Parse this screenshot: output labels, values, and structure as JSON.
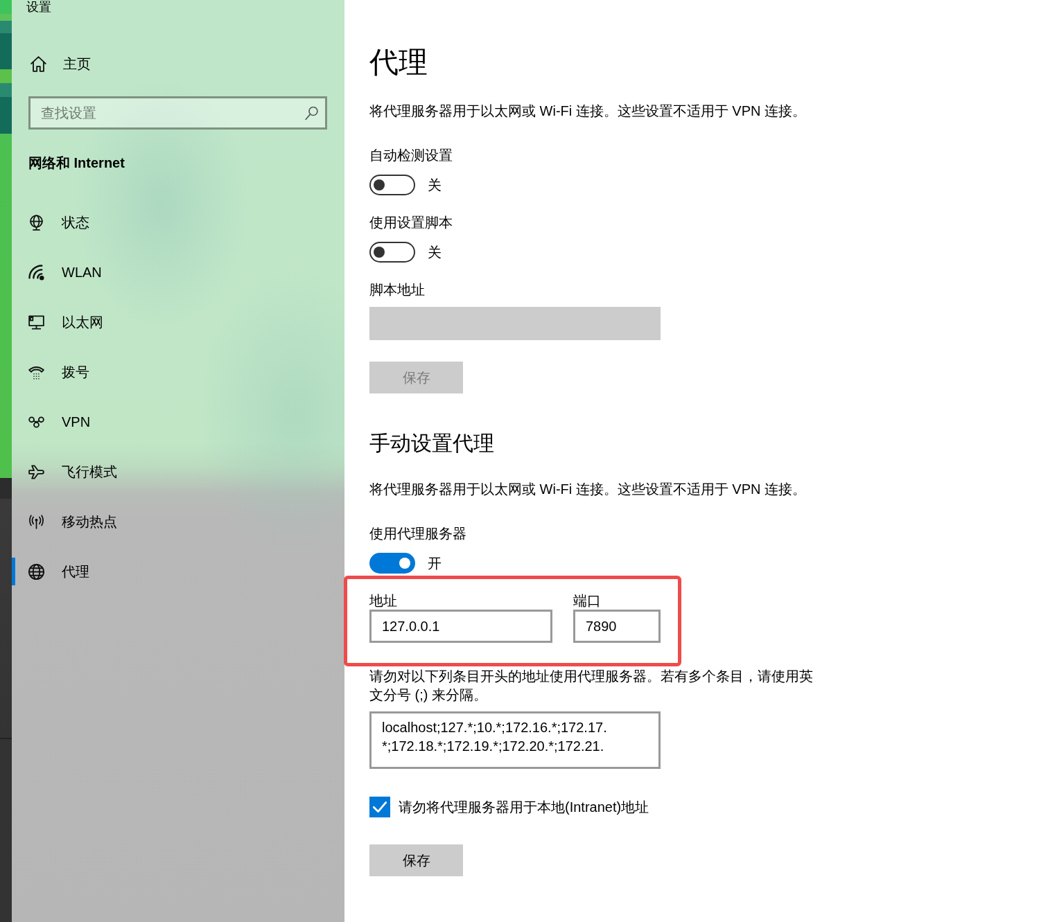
{
  "window": {
    "title": "设置"
  },
  "sidebar": {
    "home": {
      "label": "主页"
    },
    "search": {
      "placeholder": "查找设置"
    },
    "section_title": "网络和 Internet",
    "items": [
      {
        "label": "状态",
        "selected": false
      },
      {
        "label": "WLAN",
        "selected": false
      },
      {
        "label": "以太网",
        "selected": false
      },
      {
        "label": "拨号",
        "selected": false
      },
      {
        "label": "VPN",
        "selected": false
      },
      {
        "label": "飞行模式",
        "selected": false
      },
      {
        "label": "移动热点",
        "selected": false
      },
      {
        "label": "代理",
        "selected": true
      }
    ]
  },
  "page": {
    "title": "代理",
    "description": "将代理服务器用于以太网或 Wi-Fi 连接。这些设置不适用于 VPN 连接。",
    "automatic": [
      {
        "kind": "toggle",
        "label": "自动检测设置",
        "on": false,
        "state_text": "关"
      },
      {
        "kind": "toggle",
        "label": "使用设置脚本",
        "on": false,
        "state_text": "关"
      },
      {
        "kind": "field",
        "label": "脚本地址",
        "disabled": true
      },
      {
        "kind": "button",
        "label": "保存",
        "disabled": true
      }
    ]
  },
  "manual": {
    "heading": "手动设置代理",
    "description": "将代理服务器用于以太网或 Wi-Fi 连接。这些设置不适用于 VPN 连接。",
    "proxy_toggle": {
      "label": "使用代理服务器",
      "on": true,
      "state_text": "开"
    },
    "server": {
      "highlighted": true,
      "address": {
        "label": "地址",
        "value": "127.0.0.1"
      },
      "port": {
        "label": "端口",
        "value": "7890"
      }
    },
    "exceptions": {
      "label": "请勿对以下列条目开头的地址使用代理服务器。若有多个条目，请使用英文分号 (;) 来分隔。",
      "lines": [
        "localhost;127.*;10.*;172.16.*;172.17.",
        "*;172.18.*;172.19.*;172.20.*;172.21."
      ]
    },
    "bypass_local": {
      "label": "请勿将代理服务器用于本地(Intranet)地址",
      "checked": true
    },
    "save": {
      "label": "保存",
      "disabled": false
    }
  }
}
